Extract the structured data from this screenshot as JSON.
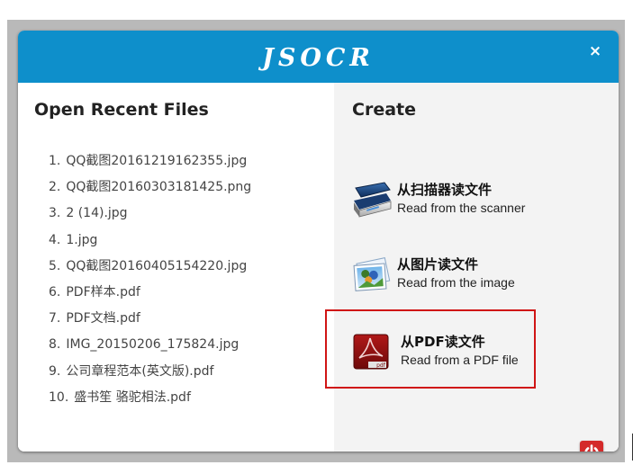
{
  "dialog": {
    "title": "JSOCR",
    "close_label": "×"
  },
  "recent": {
    "heading": "Open Recent Files",
    "files": [
      {
        "num": "1.",
        "name": "QQ截图20161219162355.jpg"
      },
      {
        "num": "2.",
        "name": "QQ截图20160303181425.png"
      },
      {
        "num": "3.",
        "name": "2 (14).jpg"
      },
      {
        "num": "4.",
        "name": "1.jpg"
      },
      {
        "num": "5.",
        "name": "QQ截图20160405154220.jpg"
      },
      {
        "num": "6.",
        "name": "PDF样本.pdf"
      },
      {
        "num": "7.",
        "name": "PDF文档.pdf"
      },
      {
        "num": "8.",
        "name": "IMG_20150206_175824.jpg"
      },
      {
        "num": "9.",
        "name": "公司章程范本(英文版).pdf"
      },
      {
        "num": "10.",
        "name": "盛书笙 骆驼相法.pdf"
      }
    ]
  },
  "create": {
    "heading": "Create",
    "scanner": {
      "cn": "从扫描器读文件",
      "en": "Read from the scanner",
      "icon": "scanner-icon"
    },
    "image": {
      "cn": "从图片读文件",
      "en": "Read from the image",
      "icon": "image-icon"
    },
    "pdf": {
      "cn": "从PDF读文件",
      "en": "Read from a PDF file",
      "icon": "pdf-icon",
      "icon_text": "pdf"
    }
  },
  "colors": {
    "titlebar": "#0e8fcb",
    "highlight": "#d01515",
    "power": "#d42a2a"
  },
  "power_icon": "power-icon"
}
